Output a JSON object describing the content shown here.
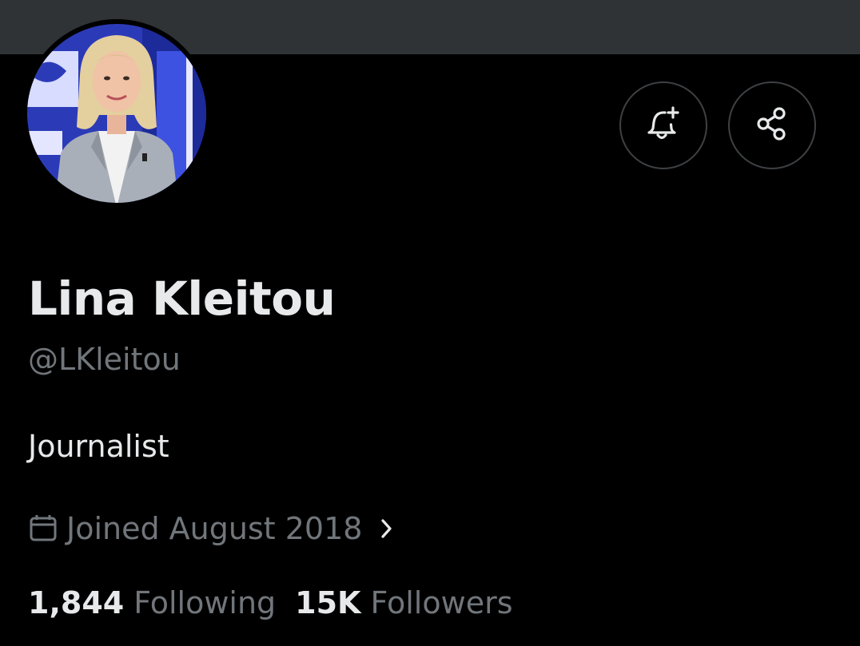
{
  "profile": {
    "display_name": "Lina Kleitou",
    "handle": "@LKleitou",
    "bio": "Journalist",
    "joined": "Joined August 2018"
  },
  "stats": {
    "following_count": "1,844",
    "following_label": "Following",
    "followers_count": "15K",
    "followers_label": "Followers"
  },
  "icons": {
    "notify": "bell-plus-icon",
    "share": "share-icon",
    "calendar": "calendar-icon",
    "chevron": "chevron-right-icon"
  },
  "colors": {
    "background": "#000000",
    "banner": "#2f3336",
    "primary_text": "#e7e9ea",
    "secondary_text": "#71767b",
    "button_border": "#3e4144"
  }
}
